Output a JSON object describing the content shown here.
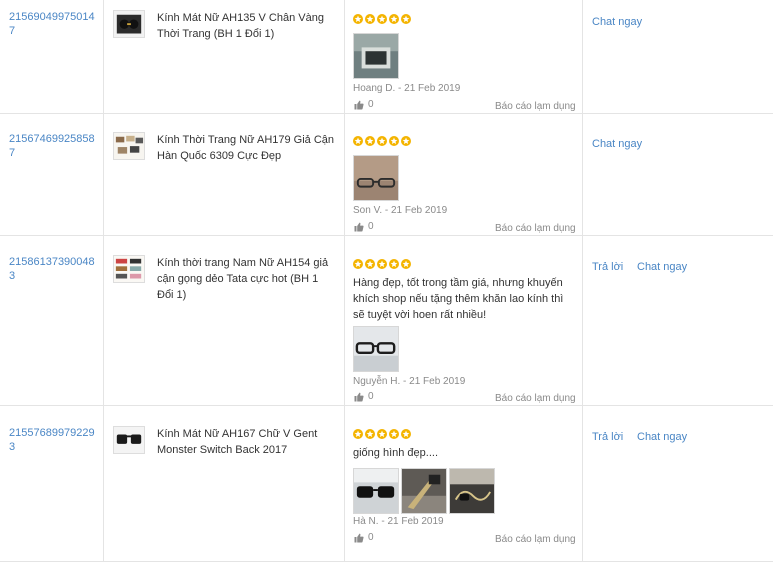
{
  "rows": [
    {
      "order_id": "215690499750147",
      "product_name": "Kính Mát Nữ AH135 V Chân Vàng Thời Trang (BH 1 Đổi 1)",
      "rating": 5,
      "review_text": "",
      "reviewer": "Hoang D. - 21 Feb 2019",
      "likes": "0",
      "report_label": "Báo cáo lạm dụng",
      "reply_label": "",
      "chat_label": "Chat ngay"
    },
    {
      "order_id": "215674699258587",
      "product_name": "Kính Thời Trang Nữ AH179 Giả Cận Hàn Quốc 6309 Cực Đẹp",
      "rating": 5,
      "review_text": "",
      "reviewer": "Son V. - 21 Feb 2019",
      "likes": "0",
      "report_label": "Báo cáo lạm dụng",
      "reply_label": "",
      "chat_label": "Chat ngay"
    },
    {
      "order_id": "215861373900483",
      "product_name": "Kính thời trang Nam Nữ AH154 giả cận gọng dẻo Tata cực hot (BH 1 Đổi 1)",
      "rating": 5,
      "review_text": "Hàng đẹp, tốt trong tầm giá, nhưng khuyến khích shop nếu tặng thêm khăn lao kính thì sẽ tuyệt vời hoen rất nhiều!",
      "reviewer": "Nguyễn H. - 21 Feb 2019",
      "likes": "0",
      "report_label": "Báo cáo lạm dụng",
      "reply_label": "Trả lời",
      "chat_label": "Chat ngay"
    },
    {
      "order_id": "215576899792293",
      "product_name": "Kính Mát Nữ AH167 Chữ V Gent Monster Switch Back 2017",
      "rating": 5,
      "review_text": "giống hình đẹp....",
      "reviewer": "Hà N. - 21 Feb 2019",
      "likes": "0",
      "report_label": "Báo cáo lạm dụng",
      "reply_label": "Trả lời",
      "chat_label": "Chat ngay"
    }
  ]
}
